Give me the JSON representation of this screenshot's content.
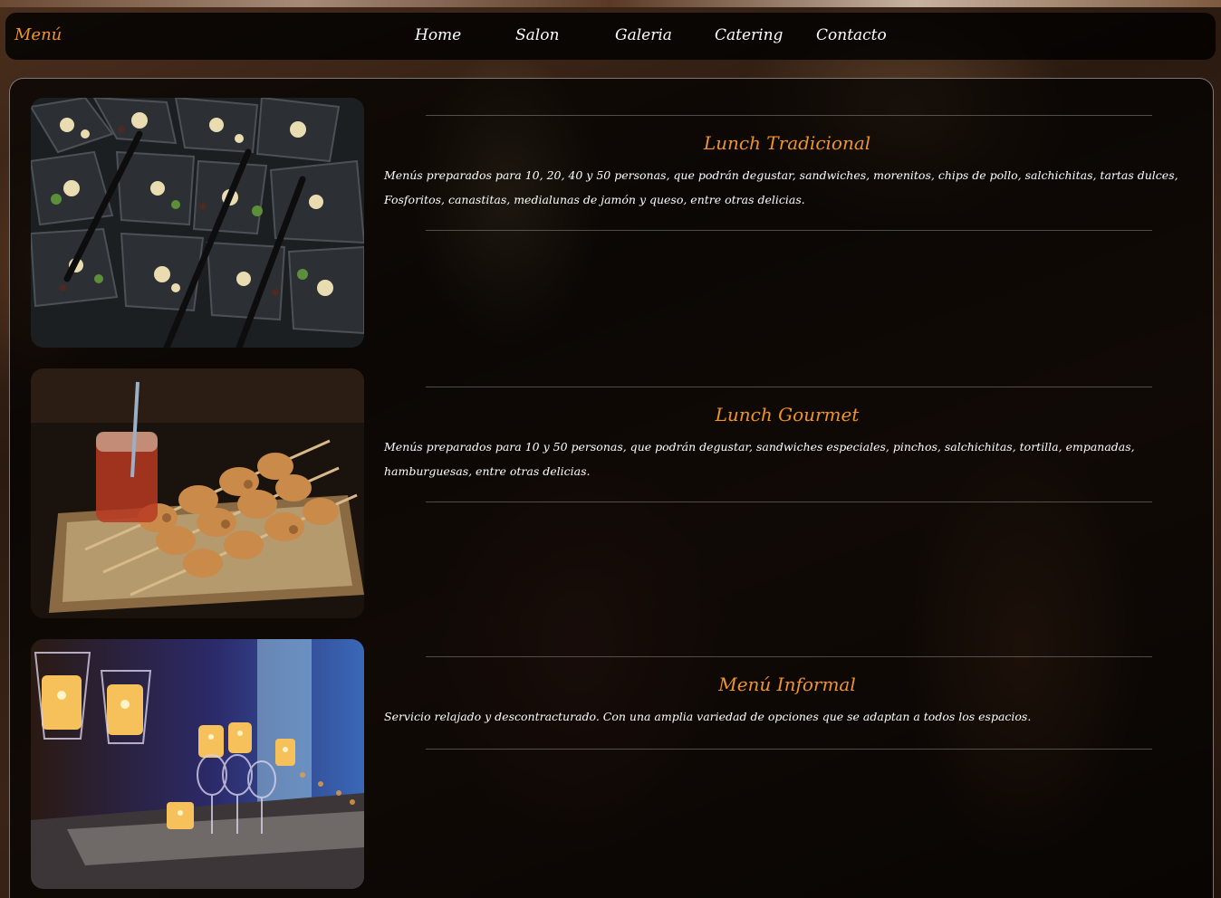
{
  "nav": {
    "brand": "Menú",
    "links": [
      "Home",
      "Salon",
      "Galeria",
      "Catering",
      "Contacto"
    ]
  },
  "sections": [
    {
      "title": "Lunch Tradicional",
      "text": "Menús preparados para 10, 20, 40 y 50 personas, que podrán degustar, sandwiches, morenitos, chips de pollo, salchichitas, tartas dulces, Fosforitos, canastitas, medialunas de jamón y queso, entre otras delicias."
    },
    {
      "title": "Lunch Gourmet",
      "text": "Menús preparados para 10 y 50 personas, que podrán degustar, sandwiches especiales, pinchos, salchichitas, tortilla, empanadas, hamburguesas, entre otras delicias."
    },
    {
      "title": "Menú Informal",
      "text": "Servicio relajado y descontracturado. Con una amplia variedad de opciones que se adaptan a todos los espacios."
    }
  ],
  "colors": {
    "accent": "#f0932b",
    "text": "#ffffff",
    "navbar_bg": "#000000"
  }
}
